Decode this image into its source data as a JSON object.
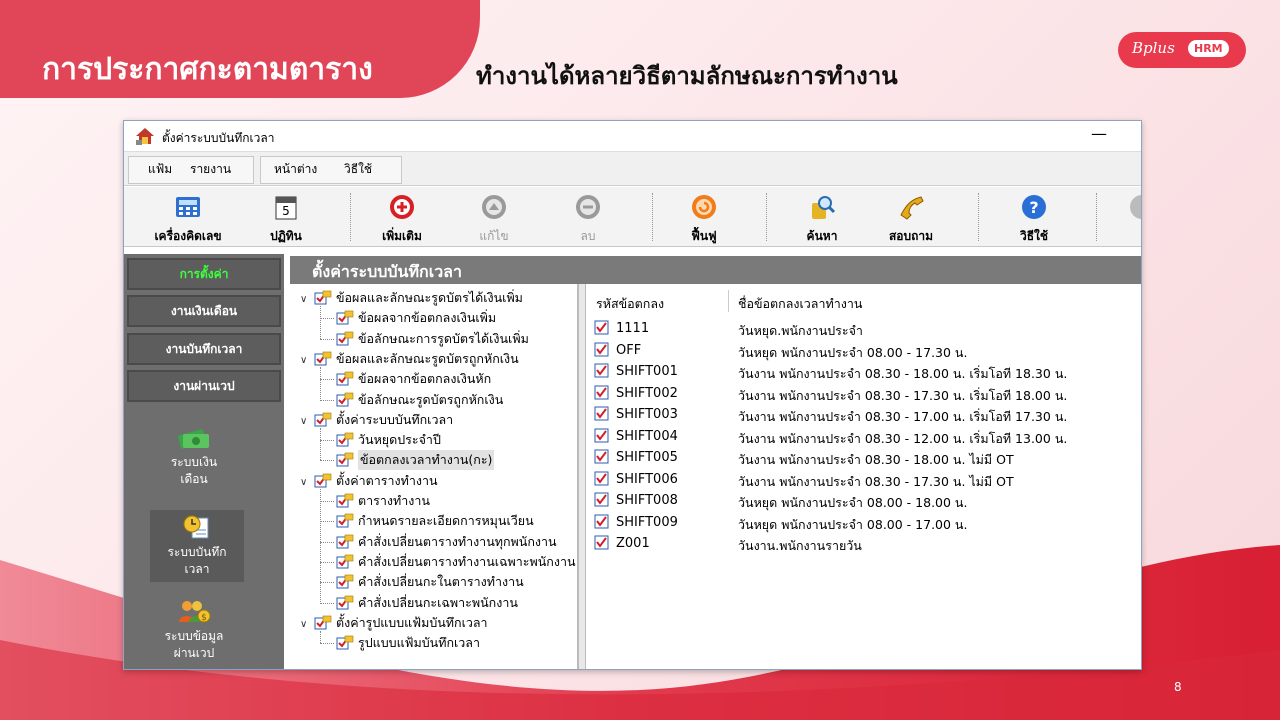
{
  "slide": {
    "title": "การประกาศกะตามตาราง",
    "subtitle": "ทำงานได้หลายวิธีตามลักษณะการทำงาน",
    "logo_brand": "Bplus",
    "logo_badge": "HRM",
    "page_number": "8",
    "accent_color": "#e04658"
  },
  "window": {
    "title": "ตั้งค่าระบบบันทึกเวลา",
    "minimize_label": "—"
  },
  "menu": {
    "items": [
      "แฟ้ม",
      "รายงาน",
      "หน้าต่าง",
      "วิธีใช้"
    ]
  },
  "toolbar": {
    "buttons": [
      {
        "label": "เครื่องคิดเลข",
        "icon": "calculator-icon",
        "enabled": true
      },
      {
        "label": "ปฏิทิน",
        "icon": "calendar-icon",
        "enabled": true
      },
      {
        "label": "เพิ่มเติม",
        "icon": "add-icon",
        "enabled": true
      },
      {
        "label": "แก้ไข",
        "icon": "edit-icon",
        "enabled": false
      },
      {
        "label": "ลบ",
        "icon": "delete-icon",
        "enabled": false
      },
      {
        "label": "ฟื้นฟู",
        "icon": "refresh-icon",
        "enabled": true
      },
      {
        "label": "ค้นหา",
        "icon": "search-icon",
        "enabled": true
      },
      {
        "label": "สอบถาม",
        "icon": "phone-icon",
        "enabled": true
      },
      {
        "label": "วิธีใช้",
        "icon": "help-icon",
        "enabled": true
      }
    ]
  },
  "sidebar": {
    "buttons": [
      {
        "label": "การตั้งค่า",
        "active": true
      },
      {
        "label": "งานเงินเดือน",
        "active": false
      },
      {
        "label": "งานบันทึกเวลา",
        "active": false
      },
      {
        "label": "งานผ่านเวป",
        "active": false
      }
    ],
    "modules": [
      {
        "line1": "ระบบเงิน",
        "line2": "เดือน",
        "icon": "money-icon",
        "selected": false
      },
      {
        "line1": "ระบบบันทึก",
        "line2": "เวลา",
        "icon": "time-record-icon",
        "selected": true
      },
      {
        "line1": "ระบบข้อมูล",
        "line2": "ผ่านเวป",
        "icon": "web-users-icon",
        "selected": false
      }
    ]
  },
  "panel": {
    "title": "ตั้งค่าระบบบันทึกเวลา"
  },
  "tree": {
    "nodes": [
      {
        "label": "ข้อผลและลักษณะรูดบัตรได้เงินเพิ่ม",
        "level": 0,
        "expander": "∨",
        "selected": false
      },
      {
        "label": "ข้อผลจากข้อตกลงเงินเพิ่ม",
        "level": 1,
        "expander": "",
        "selected": false
      },
      {
        "label": "ข้อลักษณะการรูดบัตรได้เงินเพิ่ม",
        "level": 1,
        "expander": "",
        "selected": false
      },
      {
        "label": "ข้อผลและลักษณะรูดบัตรถูกหักเงิน",
        "level": 0,
        "expander": "∨",
        "selected": false
      },
      {
        "label": "ข้อผลจากข้อตกลงเงินหัก",
        "level": 1,
        "expander": "",
        "selected": false
      },
      {
        "label": "ข้อลักษณะรูดบัตรถูกหักเงิน",
        "level": 1,
        "expander": "",
        "selected": false
      },
      {
        "label": "ตั้งค่าระบบบันทึกเวลา",
        "level": 0,
        "expander": "∨",
        "selected": false
      },
      {
        "label": "วันหยุดประจำปี",
        "level": 1,
        "expander": "",
        "selected": false
      },
      {
        "label": "ข้อตกลงเวลาทำงาน(กะ)",
        "level": 1,
        "expander": "",
        "selected": true
      },
      {
        "label": "ตั้งค่าตารางทำงาน",
        "level": 0,
        "expander": "∨",
        "selected": false
      },
      {
        "label": "ตารางทำงาน",
        "level": 1,
        "expander": "",
        "selected": false
      },
      {
        "label": "กำหนดรายละเอียดการหมุนเวียน",
        "level": 1,
        "expander": "",
        "selected": false
      },
      {
        "label": "คำสั่งเปลี่ยนตารางทำงานทุกพนักงาน",
        "level": 1,
        "expander": "",
        "selected": false
      },
      {
        "label": "คำสั่งเปลี่ยนตารางทำงานเฉพาะพนักงาน",
        "level": 1,
        "expander": "",
        "selected": false
      },
      {
        "label": "คำสั่งเปลี่ยนกะในตารางทำงาน",
        "level": 1,
        "expander": "",
        "selected": false
      },
      {
        "label": "คำสั่งเปลี่ยนกะเฉพาะพนักงาน",
        "level": 1,
        "expander": "",
        "selected": false
      },
      {
        "label": "ตั้งค่ารูปแบบแฟ้มบันทึกเวลา",
        "level": 0,
        "expander": "∨",
        "selected": false
      },
      {
        "label": "รูปแบบแฟ้มบันทึกเวลา",
        "level": 1,
        "expander": "",
        "selected": false
      }
    ]
  },
  "list": {
    "headers": {
      "code": "รหัสข้อตกลง",
      "name": "ชื่อข้อตกลงเวลาทำงาน"
    },
    "rows": [
      {
        "code": "1111",
        "name": "วันหยุด.พนักงานประจำ"
      },
      {
        "code": "OFF",
        "name": "วันหยุด พนักงานประจำ 08.00 -  17.30 น."
      },
      {
        "code": "SHIFT001",
        "name": "วันงาน พนักงานประจำ 08.30 - 18.00 น. เริ่มโอที 18.30 น."
      },
      {
        "code": "SHIFT002",
        "name": "วันงาน พนักงานประจำ 08.30 - 17.30 น. เริ่มโอที 18.00 น."
      },
      {
        "code": "SHIFT003",
        "name": "วันงาน พนักงานประจำ 08.30 - 17.00 น. เริ่มโอที 17.30 น."
      },
      {
        "code": "SHIFT004",
        "name": "วันงาน พนักงานประจำ 08.30 - 12.00 น. เริ่มโอที 13.00 น."
      },
      {
        "code": "SHIFT005",
        "name": "วันงาน พนักงานประจำ 08.30 - 18.00 น. ไม่มี OT"
      },
      {
        "code": "SHIFT006",
        "name": "วันงาน พนักงานประจำ 08.30 - 17.30  น. ไม่มี OT"
      },
      {
        "code": "SHIFT008",
        "name": "วันหยุด พนักงานประจำ 08.00 -  18.00 น."
      },
      {
        "code": "SHIFT009",
        "name": "วันหยุด พนักงานประจำ 08.00 -  17.00 น."
      },
      {
        "code": "Z001",
        "name": "วันงาน.พนักงานรายวัน"
      }
    ]
  }
}
